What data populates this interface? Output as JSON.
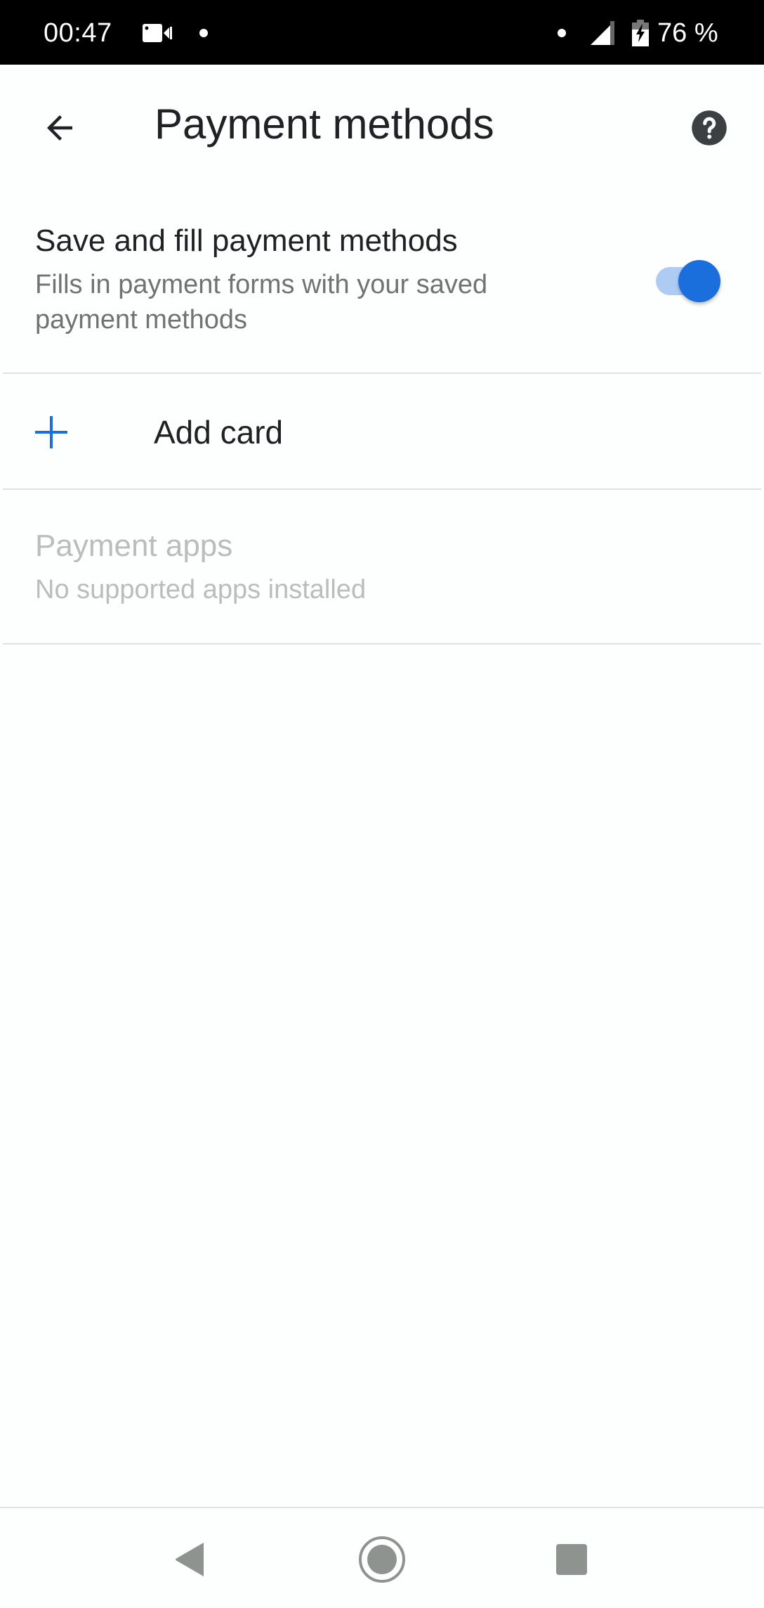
{
  "status_bar": {
    "time": "00:47",
    "battery_percent": "76 %",
    "icons": [
      "video-camera-icon",
      "notification-dot-icon",
      "notification-dot-icon",
      "cell-signal-icon",
      "battery-charging-icon"
    ]
  },
  "app_bar": {
    "title": "Payment methods",
    "back_icon": "arrow-back-icon",
    "help_icon": "help-circle-icon"
  },
  "settings": {
    "save_fill": {
      "title": "Save and fill payment methods",
      "subtitle": "Fills in payment forms with your saved payment methods",
      "enabled": true
    },
    "add_card": {
      "label": "Add card",
      "icon": "plus-icon"
    },
    "payment_apps": {
      "title": "Payment apps",
      "subtitle": "No supported apps installed",
      "disabled": true
    }
  },
  "colors": {
    "accent": "#1a6fdc",
    "switch_track": "#aecbf4",
    "disabled_text": "#b9bdbb",
    "secondary_text": "#6f7472"
  },
  "nav_bar": {
    "buttons": [
      "back",
      "home",
      "recents"
    ]
  }
}
